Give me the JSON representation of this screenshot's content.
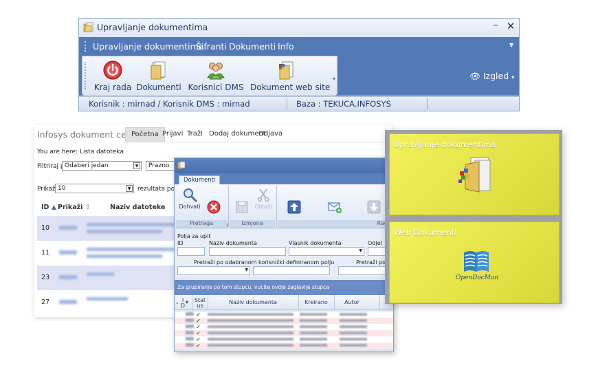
{
  "main_window": {
    "title": "Upravljanje dokumentima",
    "menu": [
      "Upravljanje dokumentima",
      "Šifranti",
      "Dokumenti",
      "Info"
    ],
    "toolbar": {
      "kraj_rada": "Kraj rada",
      "dokumenti": "Dokumenti",
      "korisnici_dms": "Korisnici DMS",
      "dokument_web_site": "Dokument web site"
    },
    "izgled": "Izgled",
    "status": {
      "korisnik": "Korisnik :  mirnad /  Korisnik DMS :  mirnad",
      "baza": "Baza :  TEKUCA.INFOSYS"
    }
  },
  "web_page": {
    "brand": "Infosys dokument centar",
    "nav": [
      "Početna",
      "Prijavi",
      "Traži",
      "Dodaj dokument",
      "Odjava"
    ],
    "breadcrumb": "You are here: Lista datoteka",
    "filter_label": "Filtriraj po:",
    "filter_select": "Odaberi jedan",
    "filter_second": "Prazno",
    "show_label": "Prikaži",
    "show_select": "10",
    "results_label": "rezultata po stra",
    "columns": [
      "ID",
      "Prikaži",
      "Naziv datoteke"
    ],
    "rows": [
      {
        "id": "10"
      },
      {
        "id": "11"
      },
      {
        "id": "23"
      },
      {
        "id": "27"
      }
    ]
  },
  "doc_window": {
    "tab": "Dokumenti",
    "ribbon": {
      "dohvati": "Dohvati",
      "ocisti": "Očisti\nfiltere",
      "spremi": "Spremi\nizmjene",
      "otkazi": "Otkaži",
      "postavi_dokument": "Postavi\ndokument",
      "postavi_email": "Postavi e-mail iz\nThunderbird - a",
      "preuzmi": "Preuzmi\ndokument",
      "groups": [
        "Pretraga",
        "Izmjena",
        "Rad"
      ]
    },
    "query": {
      "title": "Polja za upit",
      "id": "ID",
      "naziv": "Naziv dokumenta",
      "vlasnik": "Vlasnik dokumenta",
      "odjel": "Odjel",
      "pretrazi_polju": "Pretraži po odabranom korisnički definiranom polju",
      "pretrazi_o": "Pretraži po o"
    },
    "group_bar": "Za grupiranje po tom stupcu, vucite ovdje zaglavlje stupca",
    "grid_columns": [
      "I\nD",
      "Stat\nus",
      "Naziv dokumenta",
      "Kreirano",
      "Autor"
    ]
  },
  "tiles": {
    "upravljanje": "Upravljanje dokumentima",
    "web": "Web Dokumenti",
    "odm_logo": "OpenDocMan"
  }
}
